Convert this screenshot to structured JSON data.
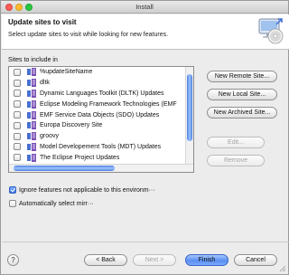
{
  "window": {
    "title": "Install"
  },
  "header": {
    "title": "Update sites to visit",
    "description": "Select update sites to visit while looking for new features."
  },
  "sites": {
    "label": "Sites to include in",
    "items": [
      {
        "label": "%updateSiteName",
        "checked": false
      },
      {
        "label": "dltk",
        "checked": false
      },
      {
        "label": "Dynamic Languages Toolkit (DLTK) Updates",
        "checked": false
      },
      {
        "label": "Eclipse Modeling Framework Technologies (EMF",
        "checked": false
      },
      {
        "label": "EMF Service Data Objects (SDO) Updates",
        "checked": false
      },
      {
        "label": "Europa Discovery Site",
        "checked": false
      },
      {
        "label": "groovy",
        "checked": false
      },
      {
        "label": "Model Developement Tools (MDT) Updates",
        "checked": false
      },
      {
        "label": "The Eclipse Project Updates",
        "checked": false
      }
    ]
  },
  "actions": {
    "new_remote": "New Remote Site...",
    "new_local": "New Local Site...",
    "new_archived": "New Archived Site...",
    "edit": "Edit...",
    "remove": "Remove"
  },
  "options": {
    "ignore_features": {
      "label": "Ignore features not applicable to this environm···",
      "checked": true
    },
    "auto_select": {
      "label": "Automatically select mirr···",
      "checked": false
    }
  },
  "footer": {
    "help": "?",
    "back": "< Back",
    "next": "Next >",
    "finish": "Finish",
    "cancel": "Cancel"
  },
  "colors": {
    "accent": "#5b8ff0",
    "site_icon_blue": "#4a6fd1",
    "site_icon_purple": "#7a4fb5"
  }
}
